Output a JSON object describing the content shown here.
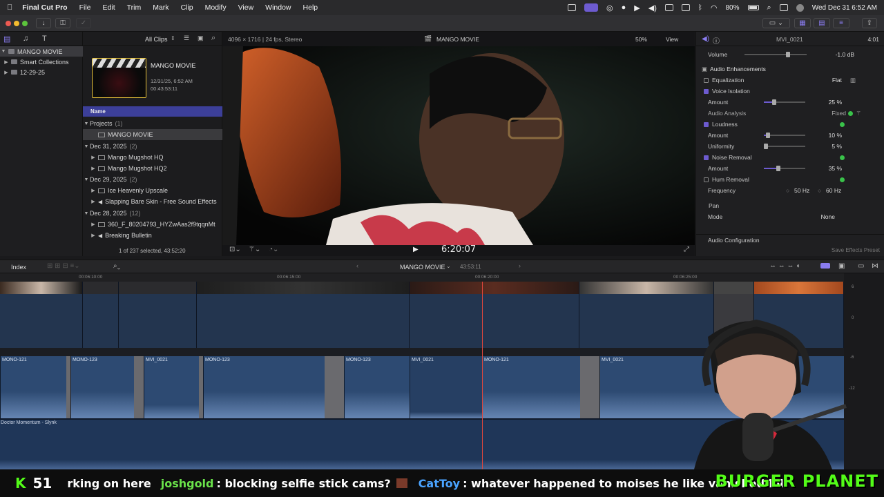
{
  "menubar": {
    "app_name": "Final Cut Pro",
    "items": [
      "File",
      "Edit",
      "Trim",
      "Mark",
      "Clip",
      "Modify",
      "View",
      "Window",
      "Help"
    ],
    "battery": "80%",
    "datetime": "Wed Dec 31  6:52 AM"
  },
  "browser_header": {
    "filter": "All Clips",
    "format": "4096 × 1716 | 24 fps, Stereo",
    "viewer_title": "MANGO MOVIE",
    "zoom": "50%",
    "view_label": "View"
  },
  "library": {
    "name": "MANGO MOVIE",
    "items": [
      "Smart Collections",
      "12-29-25"
    ]
  },
  "project_card": {
    "title": "MANGO MOVIE",
    "date": "12/31/25, 6:52 AM",
    "duration": "00:43:53:11"
  },
  "browser": {
    "column_header": "Name",
    "groups": [
      {
        "label": "Projects",
        "count": "(1)",
        "items": [
          "MANGO MOVIE"
        ]
      },
      {
        "label": "Dec 31, 2025",
        "count": "(2)",
        "items": [
          "Mango Mugshot HQ",
          "Mango Mugshot HQ2"
        ]
      },
      {
        "label": "Dec 29, 2025",
        "count": "(2)",
        "items": [
          "Ice Heavenly Upscale",
          "Slapping Bare Skin - Free Sound Effects"
        ]
      },
      {
        "label": "Dec 28, 2025",
        "count": "(12)",
        "items": [
          "360_F_80204793_HYZwAas2f9tqqnMt",
          "Breaking Bulletin"
        ]
      }
    ],
    "status": "1 of 237 selected, 43:52:20"
  },
  "viewer": {
    "timecode": "6:20:07"
  },
  "inspector": {
    "clip_name": "MVI_0021",
    "clip_duration": "4:01",
    "volume_label": "Volume",
    "volume_value": "-1.0 dB",
    "section": "Audio Enhancements",
    "equalization_label": "Equalization",
    "equalization_value": "Flat",
    "voice_isolation": "Voice Isolation",
    "vi_amount_label": "Amount",
    "vi_amount": "25 %",
    "vi_amount_frac": 0.25,
    "audio_analysis": "Audio Analysis",
    "audio_analysis_value": "Fixed",
    "loudness": "Loudness",
    "loud_amount_label": "Amount",
    "loud_amount": "10 %",
    "loud_amount_frac": 0.1,
    "uniformity_label": "Uniformity",
    "uniformity": "5 %",
    "uniformity_frac": 0.05,
    "noise_removal": "Noise Removal",
    "noise_amount_label": "Amount",
    "noise_amount": "35 %",
    "noise_amount_frac": 0.35,
    "hum_removal": "Hum Removal",
    "frequency_label": "Frequency",
    "freq_50": "50 Hz",
    "freq_60": "60 Hz",
    "pan_label": "Pan",
    "mode_label": "Mode",
    "mode_value": "None",
    "audio_config": "Audio Configuration",
    "save_preset": "Save Effects Preset"
  },
  "timeline_bar": {
    "index": "Index",
    "project": "MANGO MOVIE",
    "duration": "43:53:11"
  },
  "ruler": [
    "00:06:10:00",
    "00:06:15:00",
    "00:06:20:00",
    "00:06:25:00"
  ],
  "audio_clips": [
    "MONO-121",
    "MONO-123",
    "MVI_0021",
    "MONO-123",
    "MONO-123",
    "MVI_0021",
    "MONO-121",
    "MVI_0021"
  ],
  "music_clip": "Doctor Momentum - Slynk",
  "meter_ticks": [
    "6",
    "0",
    "-6",
    "-12"
  ],
  "ticker": {
    "count": "51",
    "msg0": "rking on here",
    "user1": "joshgold",
    "msg1": ": blocking selfie stick cams?",
    "user2": "CatToy",
    "msg2": ": whatever happened to moises he like vanished lol",
    "brand": "BURGER PLANET"
  }
}
